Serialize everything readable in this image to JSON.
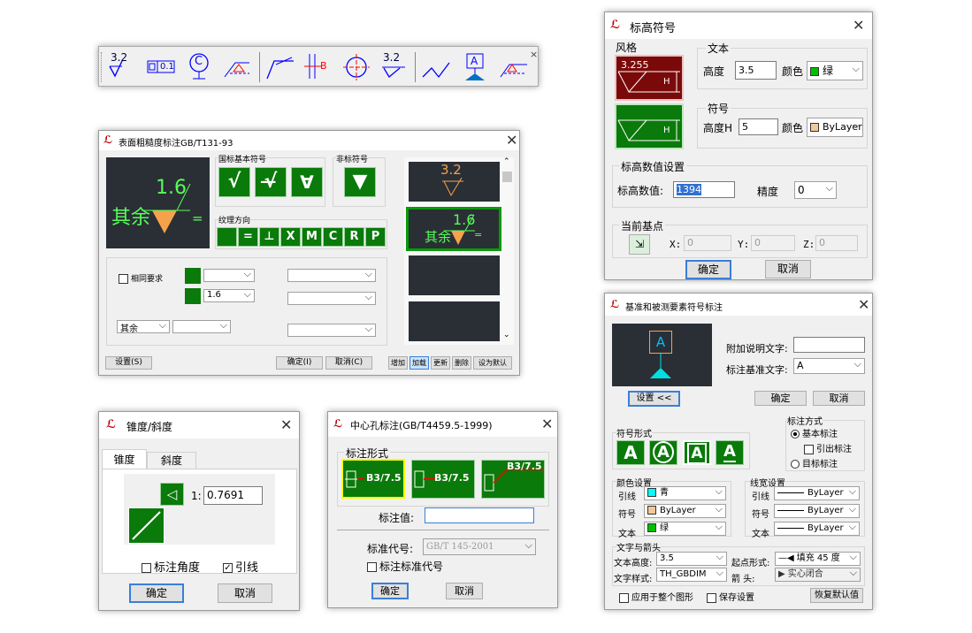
{
  "toolbar": {
    "icons": [
      "roughness-icon",
      "geometric-tolerance-icon",
      "datum-target-icon",
      "welding-icon",
      "leader-icon",
      "dimension-break-icon",
      "centerline-icon",
      "roughness-text-icon",
      "taper-icon",
      "datum-feature-icon",
      "elevation-icon"
    ],
    "label_32": "3.2",
    "label_32b": "3.2",
    "label_01": "0.1",
    "label_c": "C",
    "label_b": "B",
    "label_a": "A",
    "close": "×"
  },
  "rough": {
    "title": "表面粗糙度标注GB/T131-93",
    "preview_value": "1.6",
    "preview_rest": "其余",
    "preview_eq": "=",
    "basic_symbol_label": "国标基本符号",
    "nonstd_symbol_label": "非标符号",
    "texture_label": "纹理方向",
    "texture_items": [
      "",
      "=",
      "⊥",
      "X",
      "M",
      "C",
      "R",
      "P"
    ],
    "same_req_label": "相同要求",
    "value_field": "1.6",
    "rest_field": "其余",
    "list_top": "3.2",
    "list_sel_value": "1.6",
    "list_sel_rest": "其余",
    "list_sel_eq": "=",
    "settings_btn": "设置(S)",
    "ok_btn": "确定(I)",
    "cancel_btn": "取消(C)",
    "add_btn": "增加",
    "modify_btn": "加载",
    "update_btn": "更新",
    "delete_btn": "删除",
    "default_btn": "设为默认"
  },
  "elev": {
    "title": "标高符号",
    "style_label": "风格",
    "text_label": "文本",
    "height_label": "高度",
    "text_height": "3.5",
    "color_label": "颜色",
    "text_color": "绿",
    "symbol_label": "符号",
    "symbol_height_label": "高度H",
    "symbol_height": "5",
    "symbol_color": "ByLayer",
    "style1_value": "3.255",
    "style_h": "H",
    "value_group": "标高数值设置",
    "value_label": "标高数值:",
    "value": "1394",
    "precision_label": "精度",
    "precision": "0",
    "base_label": "当前基点",
    "x_label": "X:",
    "x": "0",
    "y_label": "Y:",
    "y": "0",
    "z_label": "Z:",
    "z": "0",
    "ok": "确定",
    "cancel": "取消",
    "colors": {
      "text": "#00c000",
      "symbol": "#f4c79a"
    }
  },
  "taper": {
    "title": "锥度/斜度",
    "tab1": "锥度",
    "tab2": "斜度",
    "ratio_prefix": "1:",
    "ratio": "0.7691",
    "annotate_angle": "标注角度",
    "leader": "引线",
    "ok": "确定",
    "cancel": "取消"
  },
  "center": {
    "title": "中心孔标注(GB/T4459.5-1999)",
    "form_label": "标注形式",
    "form_texts": [
      "B3/7.5",
      "B3/7.5",
      "B3/7.5"
    ],
    "value_label": "标注值:",
    "value": "",
    "std_label": "标准代号:",
    "std": "GB/T 145-2001",
    "annotate_std": "标注标准代号",
    "ok": "确定",
    "cancel": "取消"
  },
  "datum": {
    "title": "基准和被测要素符号标注",
    "preview_letter": "A",
    "note_label": "附加说明文字:",
    "note": "",
    "base_label": "标注基准文字:",
    "base": "A",
    "settings": "设置 <<",
    "ok": "确定",
    "cancel": "取消",
    "mode_label": "标注方式",
    "mode_basic": "基本标注",
    "mode_leader": "引出标注",
    "mode_target": "目标标注",
    "shape_label": "符号形式",
    "shapes": [
      "A",
      "A",
      "A",
      "A"
    ],
    "color_group": "颜色设置",
    "lw_group": "线宽设置",
    "leader_label": "引线",
    "symbol_label": "符号",
    "text_label": "文本",
    "leader_color": "青",
    "symbol_color": "ByLayer",
    "text_color": "绿",
    "lw_leader": "ByLayer",
    "lw_symbol": "ByLayer",
    "lw_text": "ByLayer",
    "text_arrow_group": "文字与箭头",
    "text_height_label": "文本高度:",
    "text_height": "3.5",
    "start_label": "起点形式:",
    "start": "填充 45 度",
    "text_style_label": "文字样式:",
    "text_style": "TH_GBDIM",
    "arrow_label": "箭    头:",
    "arrow": "实心闭合",
    "apply_all": "应用于整个图形",
    "save_settings": "保存设置",
    "restore_default": "恢复默认值",
    "colors": {
      "leader": "#00ffff",
      "symbol": "#f4c79a",
      "text": "#00c000"
    }
  }
}
